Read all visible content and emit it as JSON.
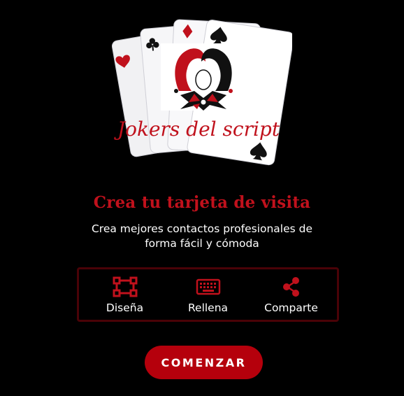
{
  "logo": {
    "brand_text": "Jokers del script",
    "card_suits": [
      "heart",
      "club",
      "diamond",
      "spade"
    ]
  },
  "hero": {
    "headline": "Crea tu tarjeta de visita",
    "subtitle_line1": "Crea mejores contactos profesionales de",
    "subtitle_line2": "forma fácil y cómoda"
  },
  "features": [
    {
      "label": "Diseña",
      "icon": "vector-square-icon"
    },
    {
      "label": "Rellena",
      "icon": "keyboard-icon"
    },
    {
      "label": "Comparte",
      "icon": "share-icon"
    }
  ],
  "cta": {
    "label": "COMENZAR"
  },
  "colors": {
    "background": "#000000",
    "accent": "#c0111c",
    "button": "#b5000c",
    "border": "#4a0207"
  }
}
